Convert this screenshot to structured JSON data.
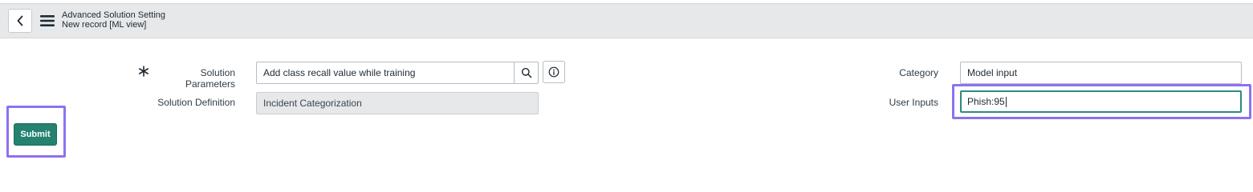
{
  "header": {
    "title": "Advanced Solution Setting",
    "subtitle": "New record [ML view]",
    "back_icon": "chevron-left-icon",
    "menu_icon": "hamburger-menu-icon"
  },
  "form": {
    "solution_parameters": {
      "label": "Solution Parameters",
      "value": "Add class recall value while training",
      "required": true
    },
    "solution_definition": {
      "label": "Solution Definition",
      "value": "Incident Categorization"
    },
    "category": {
      "label": "Category",
      "value": "Model input"
    },
    "user_inputs": {
      "label": "User Inputs",
      "value": "Phish:95"
    }
  },
  "actions": {
    "submit_label": "Submit"
  },
  "colors": {
    "accent": "#24826f",
    "highlight": "#8c72f0",
    "header_bg": "#e6e8ea"
  }
}
